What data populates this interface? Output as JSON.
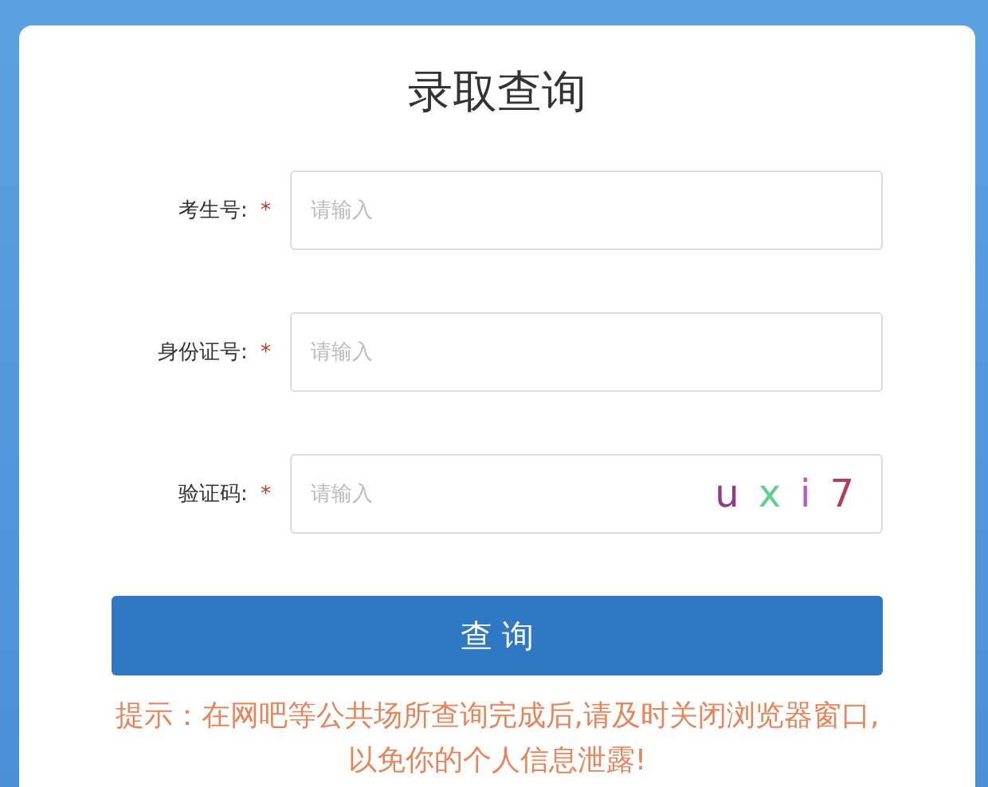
{
  "title": "录取查询",
  "fields": [
    {
      "label": "考生号:",
      "required_mark": "*",
      "placeholder": "请输入",
      "kind": "text"
    },
    {
      "label": "身份证号:",
      "required_mark": "*",
      "placeholder": "请输入",
      "kind": "text"
    },
    {
      "label": "验证码:",
      "required_mark": "*",
      "placeholder": "请输入",
      "kind": "captcha",
      "captcha": [
        {
          "char": "u",
          "color": "#8e3b8a"
        },
        {
          "char": "x",
          "color": "#5fd08a"
        },
        {
          "char": "i",
          "color": "#b85cc0"
        },
        {
          "char": "7",
          "color": "#b83a5a"
        }
      ]
    }
  ],
  "submit_button": "查 询",
  "notice": "提示：在网吧等公共场所查询完成后,请及时关闭浏览器窗口,以免你的个人信息泄露!"
}
